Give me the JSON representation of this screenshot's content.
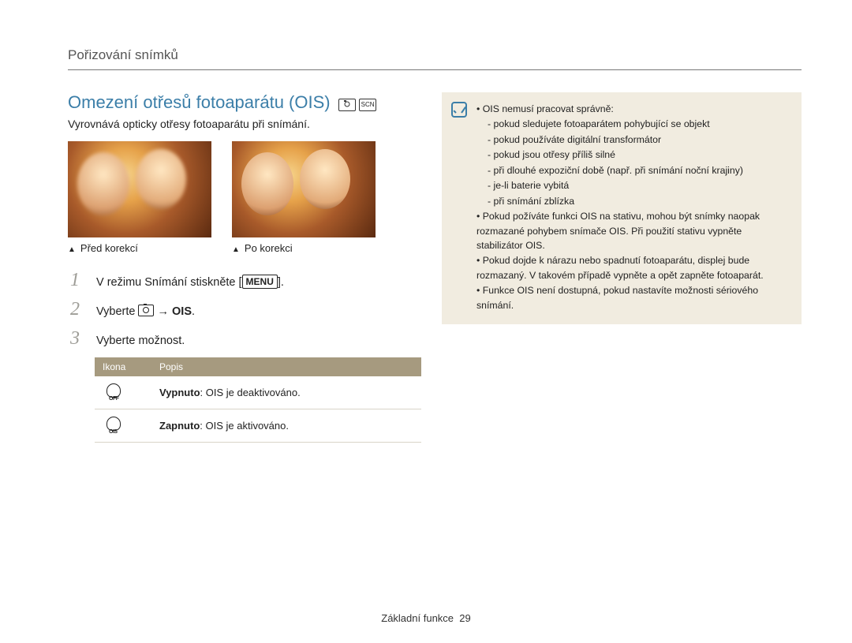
{
  "section_header": "Pořizování snímků",
  "title": "Omezení otřesů fotoaparátu (OIS)",
  "intro": "Vyrovnává opticky otřesy fotoaparátu při snímání.",
  "caption_before": "Před korekcí",
  "caption_after": "Po korekci",
  "steps": {
    "s1_a": "V režimu Snímání stiskněte [",
    "s1_menu": "MENU",
    "s1_b": "].",
    "s2_a": "Vyberte ",
    "s2_arrow": " → ",
    "s2_ois": "OIS",
    "s2_b": ".",
    "s3": "Vyberte možnost."
  },
  "table": {
    "head_icon": "Ikona",
    "head_desc": "Popis",
    "rows": [
      {
        "sub": "OFF",
        "bold": "Vypnuto",
        "rest": ": OIS je deaktivováno."
      },
      {
        "sub": "OIS",
        "bold": "Zapnuto",
        "rest": ": OIS je aktivováno."
      }
    ]
  },
  "notes": {
    "b1": "OIS nemusí pracovat správně:",
    "d1": "pokud sledujete fotoaparátem pohybující se objekt",
    "d2": "pokud používáte digitální transformátor",
    "d3": "pokud jsou otřesy příliš silné",
    "d4": "při dlouhé expoziční době (např. při snímání noční krajiny)",
    "d5": "je-li baterie vybitá",
    "d6": "při snímání zblízka",
    "b2": "Pokud požíváte funkci OIS na stativu, mohou být snímky naopak rozmazané pohybem snímače OIS. Při použití stativu vypněte stabilizátor OIS.",
    "b3": "Pokud dojde k nárazu nebo spadnutí fotoaparátu, displej bude rozmazaný. V takovém případě vypněte a opět zapněte fotoaparát.",
    "b4": "Funkce OIS není dostupná, pokud nastavíte možnosti sériového snímání."
  },
  "footer_a": "Základní funkce",
  "footer_page": "29"
}
